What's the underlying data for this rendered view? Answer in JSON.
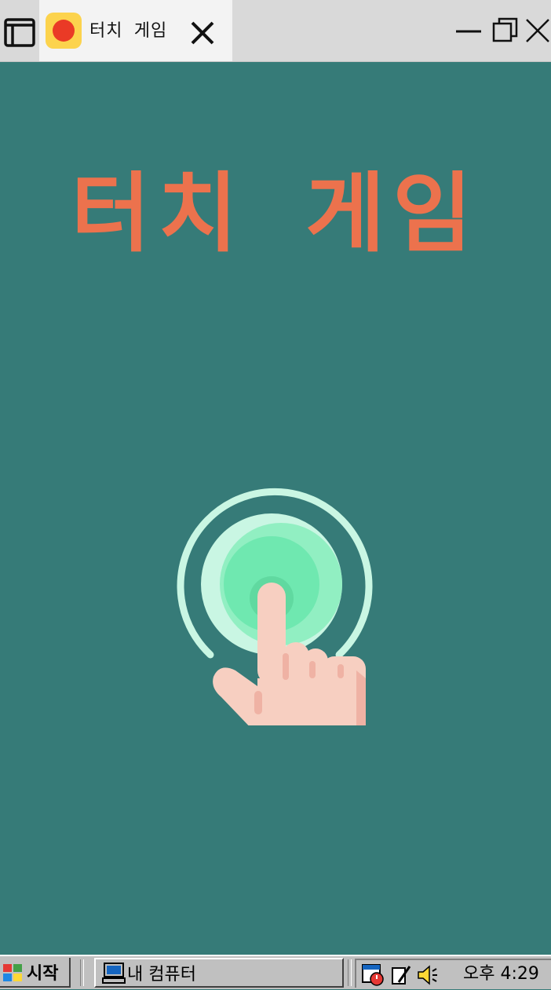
{
  "window": {
    "tab_title": "터치 게임",
    "tab_favicon": "red-dot-favicon"
  },
  "app": {
    "title": "터치 게임",
    "illustration": "touch-hand-icon",
    "colors": {
      "background": "#367b78",
      "title": "#ec724d",
      "ring": "#6fe8b0",
      "hand": "#f7cfc1"
    }
  },
  "taskbar": {
    "start_label": "시작",
    "task_label": "내 컴퓨터",
    "clock": "오후 4:29"
  }
}
